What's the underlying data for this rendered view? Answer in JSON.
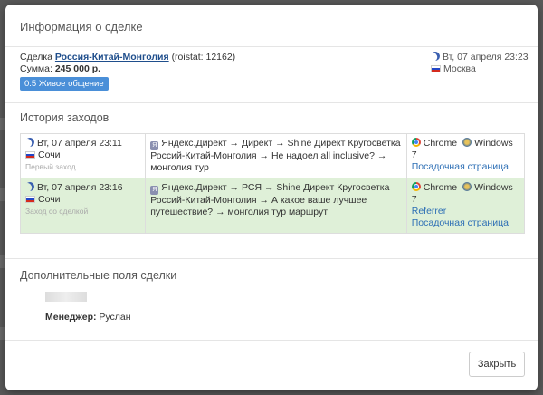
{
  "modal": {
    "title": "Информация о сделке",
    "close_button": "Закрыть"
  },
  "deal": {
    "prefix": "Сделка",
    "name": "Россия-Китай-Монголия",
    "roistat": "(roistat: 12162)",
    "sum_label": "Сумма:",
    "sum_value": "245 000 р.",
    "stage_badge": "0.5 Живое общение",
    "created": "Вт, 07 апреля 23:23",
    "city": "Москва"
  },
  "history": {
    "title": "История заходов",
    "rows": [
      {
        "datetime": "Вт, 07 апреля 23:11",
        "city": "Сочи",
        "note": "Первый заход",
        "highlight": false,
        "source": "Яндекс.Директ → Директ → Shine Директ Кругосветка Россий-Китай-Монголия → Не надоел all inclusive? → монголия тур",
        "browser": "Chrome",
        "os": "Windows 7",
        "links": [
          "Посадочная страница"
        ]
      },
      {
        "datetime": "Вт, 07 апреля 23:16",
        "city": "Сочи",
        "note": "Заход со сделкой",
        "highlight": true,
        "source": "Яндекс.Директ → РСЯ → Shine Директ Кругосветка Россий-Китай-Монголия → А какое ваше лучшее путешествие? → монголия тур маршрут",
        "browser": "Chrome",
        "os": "Windows 7",
        "links": [
          "Referrer",
          "Посадочная страница"
        ]
      }
    ]
  },
  "extra": {
    "title": "Дополнительные поля сделки",
    "manager_label": "Менеджер:",
    "manager_value": "Руслан"
  },
  "colors": {
    "highlight_row": "#dff0d8",
    "badge": "#4a8fd8",
    "link": "#2d6fb5"
  }
}
